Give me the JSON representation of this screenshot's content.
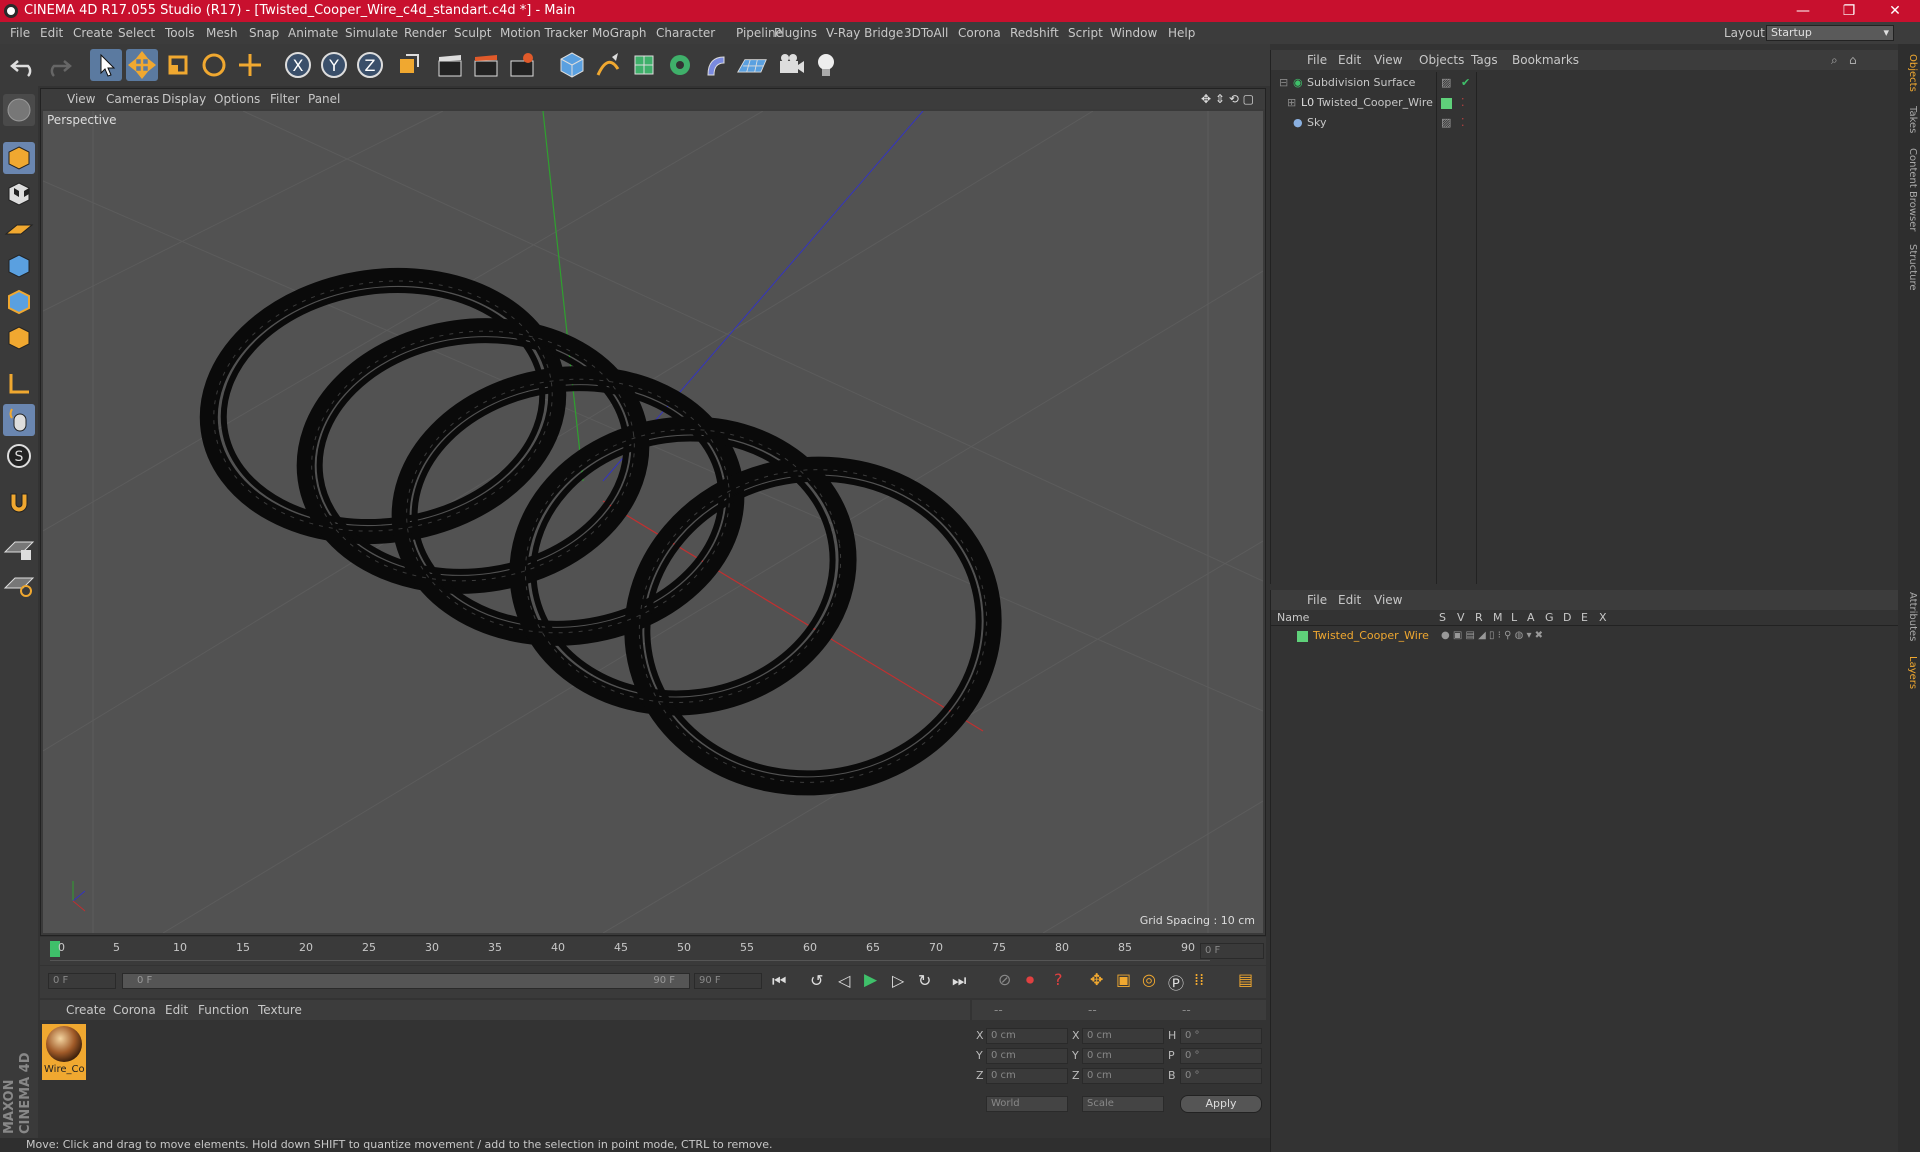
{
  "window": {
    "title": "CINEMA 4D R17.055 Studio (R17) - [Twisted_Cooper_Wire_c4d_standart.c4d *] - Main",
    "minimize": "—",
    "maximize": "❐",
    "close": "✕"
  },
  "menubar": {
    "items": [
      "File",
      "Edit",
      "Create",
      "Select",
      "Tools",
      "Mesh",
      "Snap",
      "Animate",
      "Simulate",
      "Render",
      "Sculpt",
      "Motion Tracker",
      "MoGraph",
      "Character",
      "Pipeline",
      "Plugins",
      "V-Ray Bridge",
      "3DToAll",
      "Corona",
      "Redshift",
      "Script",
      "Window",
      "Help"
    ],
    "layout_label": "Layout:",
    "layout_value": "Startup"
  },
  "viewport": {
    "menu": [
      "View",
      "Cameras",
      "Display",
      "Options",
      "Filter",
      "Panel"
    ],
    "camera": "Perspective",
    "grid_spacing": "Grid Spacing : 10 cm"
  },
  "timeline": {
    "ticks": [
      "0",
      "5",
      "10",
      "15",
      "20",
      "25",
      "30",
      "35",
      "40",
      "45",
      "50",
      "55",
      "60",
      "65",
      "70",
      "75",
      "80",
      "85",
      "90"
    ],
    "current": "0 F"
  },
  "transport": {
    "start": "0 F",
    "range_start": "0 F",
    "range_end": "90 F",
    "end": "90 F"
  },
  "material_manager": {
    "menu": [
      "Create",
      "Corona",
      "Edit",
      "Function",
      "Texture"
    ],
    "material_name": "Wire_Co"
  },
  "coordinates": {
    "headers": [
      "--",
      "--",
      "--"
    ],
    "rows": [
      {
        "a": "X",
        "av": "0 cm",
        "b": "X",
        "bv": "0 cm",
        "c": "H",
        "cv": "0 °"
      },
      {
        "a": "Y",
        "av": "0 cm",
        "b": "Y",
        "bv": "0 cm",
        "c": "P",
        "cv": "0 °"
      },
      {
        "a": "Z",
        "av": "0 cm",
        "b": "Z",
        "bv": "0 cm",
        "c": "B",
        "cv": "0 °"
      }
    ],
    "mode": "World",
    "scale": "Scale",
    "apply": "Apply"
  },
  "object_manager": {
    "menu": [
      "File",
      "Edit",
      "View",
      "Objects",
      "Tags",
      "Bookmarks"
    ],
    "objects": [
      {
        "name": "Subdivision Surface"
      },
      {
        "name": "Twisted_Cooper_Wire"
      },
      {
        "name": "Sky"
      }
    ]
  },
  "layer_manager": {
    "menu": [
      "File",
      "Edit",
      "View"
    ],
    "columns": [
      "Name",
      "S",
      "V",
      "R",
      "M",
      "L",
      "A",
      "G",
      "D",
      "E",
      "X"
    ],
    "layer": "Twisted_Cooper_Wire"
  },
  "side_tabs": [
    "Objects",
    "Takes",
    "Content Browser",
    "Structure",
    "Attributes",
    "Layers"
  ],
  "branding": "MAXON CINEMA 4D",
  "status": "Move: Click and drag to move elements. Hold down SHIFT to quantize movement / add to the selection in point mode, CTRL to remove.",
  "colors": {
    "accent": "#c8102e",
    "highlight": "#f0a830",
    "layer_green": "#5fd17a"
  }
}
